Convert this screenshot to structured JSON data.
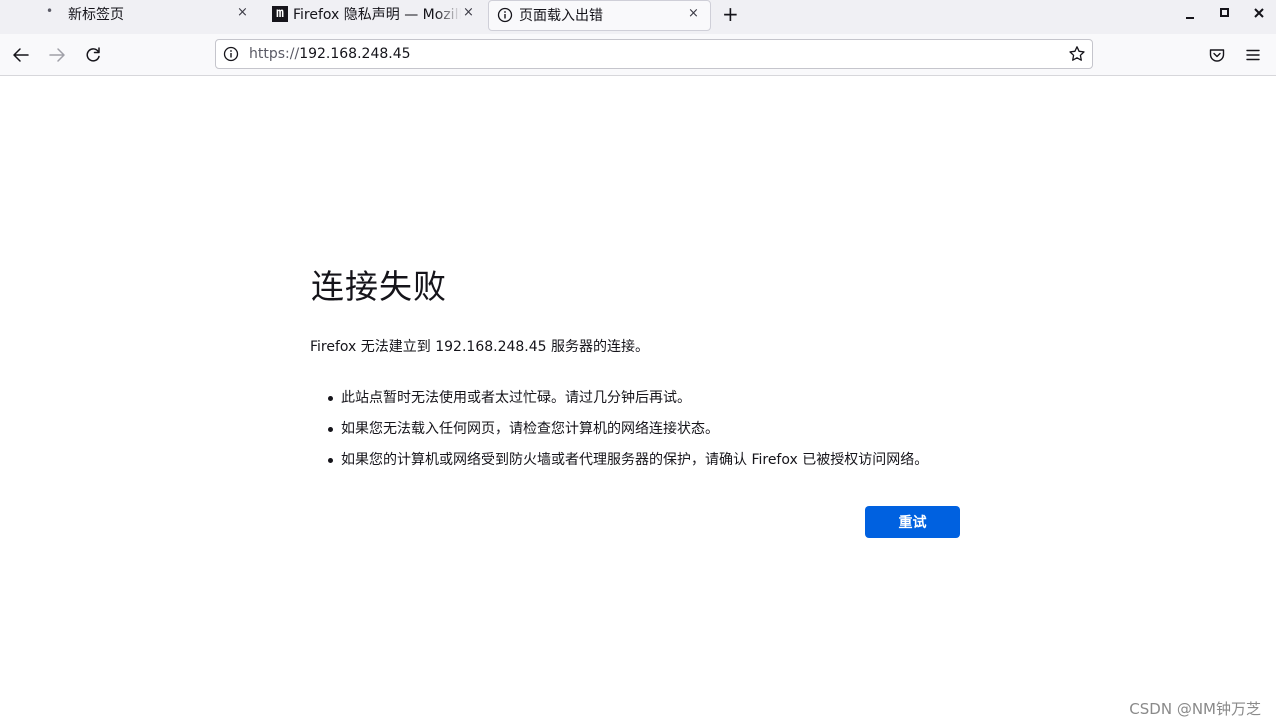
{
  "tabs": [
    {
      "title": "新标签页",
      "close": "×"
    },
    {
      "title": "Firefox 隐私声明 — Mozilla",
      "favicon": "m",
      "close": "×"
    },
    {
      "title": "页面载入出错",
      "close": "×",
      "active": true
    }
  ],
  "new_tab": "+",
  "window_controls": {
    "minimize": "—",
    "maximize": "□",
    "close": "✕"
  },
  "url": {
    "scheme": "https://",
    "host": "192.168.248.45"
  },
  "error": {
    "title": "连接失败",
    "description": "Firefox 无法建立到 192.168.248.45 服务器的连接。",
    "items": [
      "此站点暂时无法使用或者太过忙碌。请过几分钟后再试。",
      "如果您无法载入任何网页，请检查您计算机的网络连接状态。",
      "如果您的计算机或网络受到防火墙或者代理服务器的保护，请确认 Firefox 已被授权访问网络。"
    ],
    "retry_label": "重试"
  },
  "watermark": "CSDN @NM钟万芝",
  "colors": {
    "accent": "#0061e0",
    "tabbar": "#f0f0f4",
    "toolbar": "#f9f9fb"
  },
  "icons": [
    "back-arrow-icon",
    "forward-arrow-icon",
    "reload-icon",
    "info-icon",
    "star-icon",
    "pocket-icon",
    "hamburger-menu-icon"
  ]
}
